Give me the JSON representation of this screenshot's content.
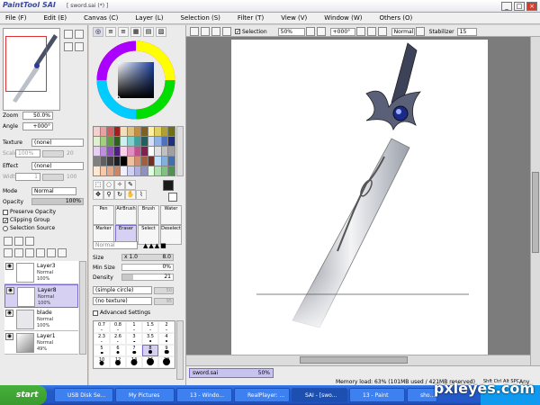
{
  "window": {
    "logo": "PaintTool SAI",
    "title": "[ sword.sai (*) ]",
    "min": "_",
    "max": "□",
    "close": "×"
  },
  "menu": [
    "File (F)",
    "Edit (E)",
    "Canvas (C)",
    "Layer (L)",
    "Selection (S)",
    "Filter (T)",
    "View (V)",
    "Window (W)",
    "Others (O)"
  ],
  "navigator": {
    "zoom_label": "Zoom",
    "zoom_value": "50.0%",
    "angle_label": "Angle",
    "angle_value": "+000°"
  },
  "texture": {
    "label": "Texture",
    "value": "(none)",
    "scale_label": "Scale",
    "scale_value": "100%",
    "scale_num": "20"
  },
  "effect": {
    "label": "Effect",
    "value": "(none)",
    "width_label": "Width",
    "width_value": "1",
    "width_num": "100"
  },
  "mode": {
    "label": "Mode",
    "value": "Normal"
  },
  "opacity": {
    "label": "Opacity",
    "value": "100%"
  },
  "checks": {
    "preserve_opacity": "Preserve Opacity",
    "clipping_group": "Clipping Group",
    "selection_source": "Selection Source"
  },
  "layers": [
    {
      "name": "Layer3",
      "mode": "Normal",
      "opacity": "100%",
      "selected": false
    },
    {
      "name": "Layer8",
      "mode": "Normal",
      "opacity": "100%",
      "selected": true
    },
    {
      "name": "blade",
      "mode": "Normal",
      "opacity": "100%",
      "selected": false
    },
    {
      "name": "Layer1",
      "mode": "Normal",
      "opacity": "49%",
      "selected": false
    }
  ],
  "brushes": {
    "row1": [
      "Pen",
      "AirBrush",
      "Brush",
      "Water"
    ],
    "row2": [
      "Marker",
      "Eraser",
      "Select",
      "Deselect"
    ]
  },
  "tool_settings": {
    "blend_mode": "Normal",
    "size_label": "Size",
    "size_mult": "x 1.0",
    "size_value": "8.0",
    "minsize_label": "Min Size",
    "minsize_value": "0%",
    "density_label": "Density",
    "density_value": "21",
    "shape": "(simple circle)",
    "shape_num": "50",
    "texture": "(no texture)",
    "texture_num": "95",
    "advanced": "Advanced Settings"
  },
  "sizes": [
    "0.7",
    "0.8",
    "1",
    "1.5",
    "2",
    "2.3",
    "2.6",
    "3",
    "3.5",
    "4",
    "5",
    "6",
    "7",
    "8",
    "9",
    "10",
    "12",
    "14",
    "16",
    "20"
  ],
  "canvas_toolbar": {
    "selection": "Selection",
    "zoom": "50%",
    "angle": "+000°",
    "mode": "Normal",
    "stabilizer_label": "Stabilizer",
    "stabilizer_value": "15"
  },
  "status": {
    "file": "sword.sai",
    "file_zoom": "50%",
    "memory": "Memory load: 63% (101MB used / 421MB reserved)",
    "keys": "Shft Ctrl Alt SPC",
    "any": "Any"
  },
  "taskbar": {
    "start": "start",
    "tasks": [
      "USB Disk Se...",
      "My Pictures",
      "13 - Windo...",
      "RealPlayer: ...",
      "SAI - [swo...",
      "13 - Paint",
      "sho..."
    ]
  },
  "watermark": "pxleyes.com",
  "colors": {
    "current": "#1a1a1a",
    "accent": "#6a5cd0",
    "taskbar": "#245ddb"
  }
}
